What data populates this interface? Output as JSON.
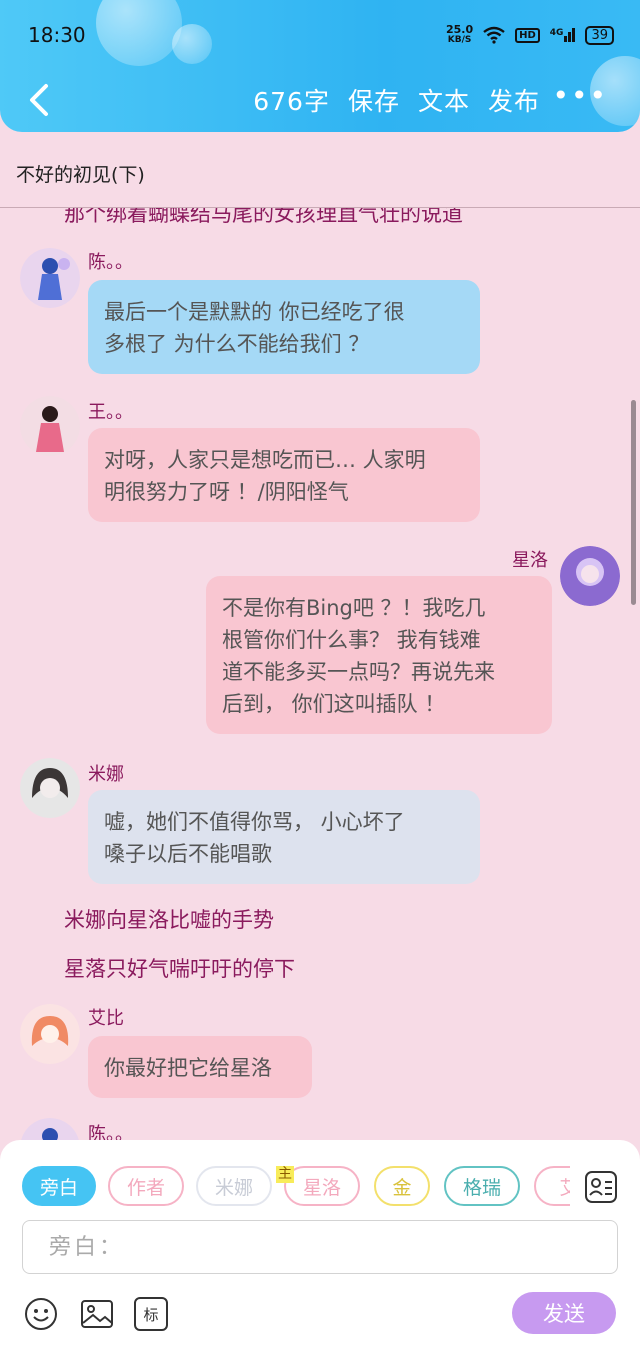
{
  "status_bar": {
    "time": "18:30",
    "speed_value": "25.0",
    "speed_unit": "KB/S",
    "hd": "HD",
    "signal": "4G",
    "battery": "39"
  },
  "header": {
    "word_count": "676字",
    "save": "保存",
    "text": "文本",
    "publish": "发布",
    "more": "•••"
  },
  "story_title": "不好的初见(下)",
  "messages": [
    {
      "type": "narration",
      "text": "那个绑着蝴蝶结马尾的女孩理直气壮的说道"
    },
    {
      "type": "left",
      "name": "陈。。",
      "text": "最后一个是默默的 你已经吃了很多根了 为什么不能给我们 ？",
      "lines": [
        "最后一个是默默的 你已经吃了很",
        "多根了 为什么不能给我们 ？"
      ]
    },
    {
      "type": "left",
      "name": "王。。",
      "lines": [
        "对呀，人家只是想吃而已… 人家明",
        "明很努力了呀 ！/阴阳怪气"
      ]
    },
    {
      "type": "right",
      "name": "星洛",
      "lines": [
        "不是你有Bing吧 ？！我吃几",
        "根管你们什么事？ 我有钱难",
        "道不能多买一点吗？再说先来",
        "后到， 你们这叫插队 ！"
      ]
    },
    {
      "type": "left",
      "name": "米娜",
      "lines": [
        "嘘，她们不值得你骂， 小心坏了",
        "嗓子以后不能唱歌"
      ]
    },
    {
      "type": "narration",
      "text": "米娜向星洛比嘘的手势"
    },
    {
      "type": "narration",
      "text": "星落只好气喘吁吁的停下"
    },
    {
      "type": "left",
      "name": "艾比",
      "lines": [
        "你最好把它给星洛"
      ]
    },
    {
      "type": "left",
      "name": "陈。。"
    }
  ],
  "roles": [
    {
      "label": "旁白",
      "selected": true,
      "color": "#45c4f3"
    },
    {
      "label": "作者",
      "color": "#f6b3c6"
    },
    {
      "label": "米娜",
      "color": "#d9dde8",
      "badge": "主"
    },
    {
      "label": "星洛",
      "color": "#f6b3c6"
    },
    {
      "label": "金",
      "color": "#f3e06c"
    },
    {
      "label": "格瑞",
      "color": "#62c3c3"
    },
    {
      "label": "艾",
      "color": "#f6b3c6"
    }
  ],
  "composer": {
    "placeholder": "旁白：",
    "send": "发送",
    "tag_tool": "标"
  },
  "icons": {
    "back": "chevron-left-icon",
    "roles": "roles-list-icon",
    "emoji": "smiley-icon",
    "image": "image-icon",
    "tag": "tag-icon"
  }
}
